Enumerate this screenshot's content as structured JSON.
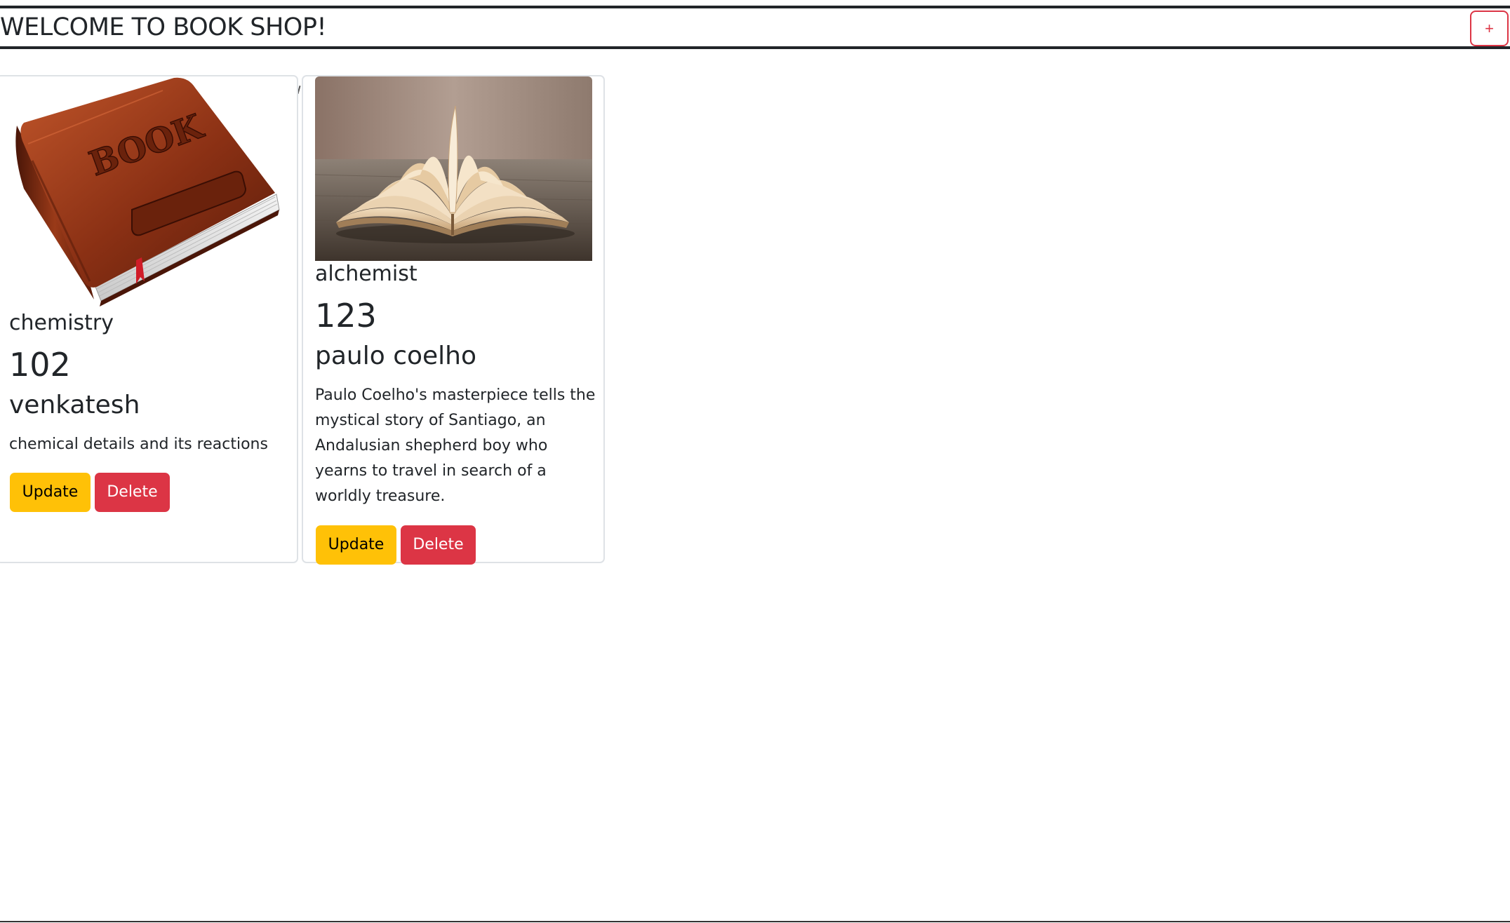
{
  "header": {
    "title": "WELCOME TO BOOK SHOP!",
    "add_label": "+"
  },
  "colors": {
    "update": "#ffc107",
    "delete": "#dc3545",
    "text": "#212529",
    "card_border": "#dee2e6"
  },
  "books": [
    {
      "image": "leather-book-icon",
      "title": "chemistry",
      "id": "102",
      "author": "venkatesh",
      "description": "chemical details and its reactions",
      "update_label": "Update",
      "delete_label": "Delete"
    },
    {
      "image": "open-book-photo",
      "title": "alchemist",
      "id": "123",
      "author": "paulo coelho",
      "description": "Paulo Coelho's masterpiece tells the mystical story of Santiago, an Andalusian shepherd boy who yearns to travel in search of a worldly treasure.",
      "update_label": "Update",
      "delete_label": "Delete"
    }
  ]
}
